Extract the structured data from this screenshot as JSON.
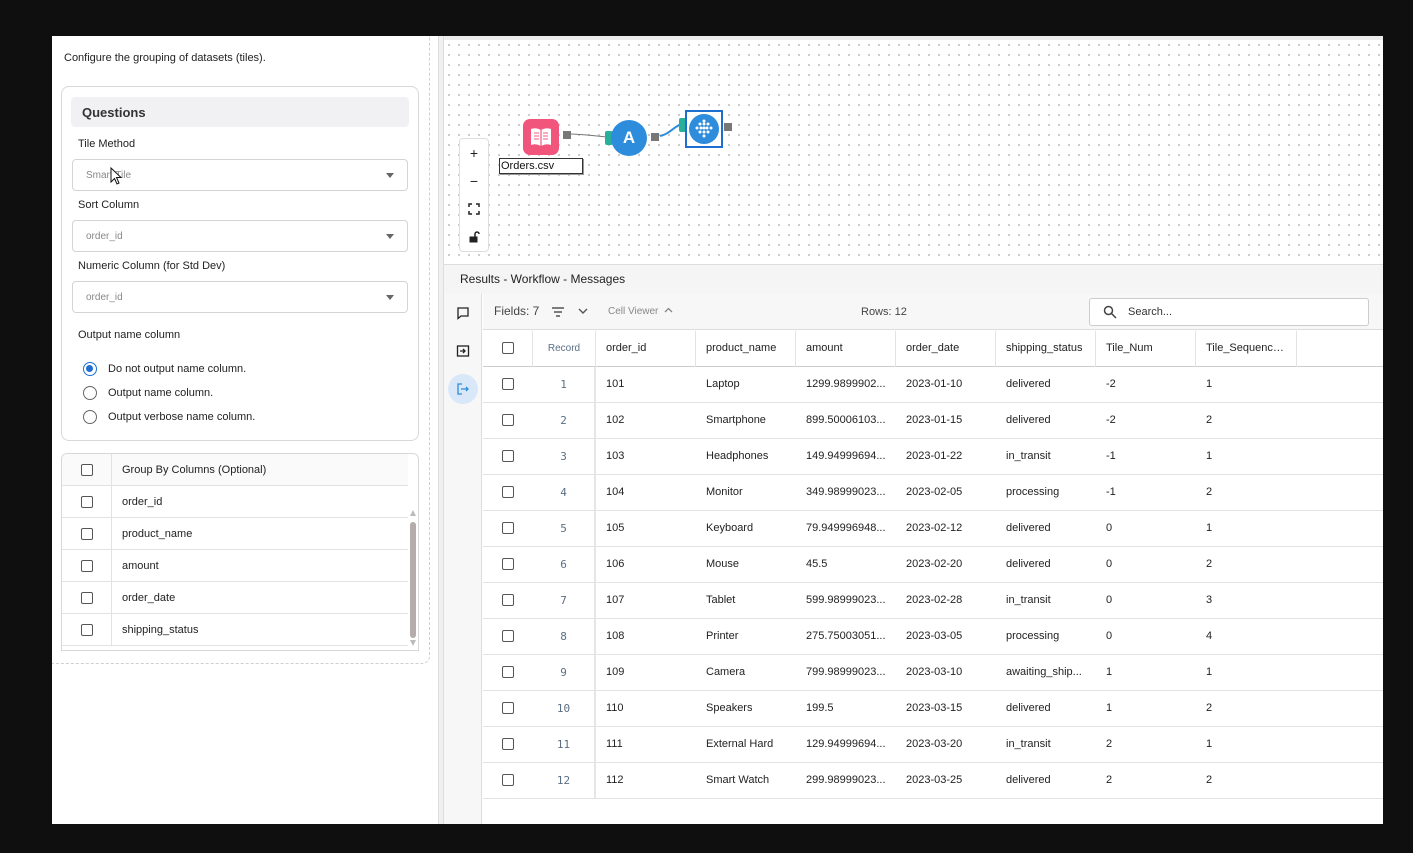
{
  "left": {
    "description": "Configure the grouping of datasets (tiles).",
    "questions_title": "Questions",
    "tile_method_label": "Tile Method",
    "tile_method_value": "Smart Tile",
    "sort_column_label": "Sort Column",
    "sort_column_value": "order_id",
    "numeric_column_label": "Numeric Column (for Std Dev)",
    "numeric_column_value": "order_id",
    "output_name_label": "Output name column",
    "radio_options": [
      {
        "label": "Do not output name column.",
        "selected": true
      },
      {
        "label": "Output name column.",
        "selected": false
      },
      {
        "label": "Output verbose name column.",
        "selected": false
      }
    ],
    "group_by_header": "Group By Columns (Optional)",
    "group_by_columns": [
      "order_id",
      "product_name",
      "amount",
      "order_date",
      "shipping_status"
    ]
  },
  "canvas": {
    "input_node_label": "Orders.csv",
    "select_node_letter": "A",
    "zoom_in": "+",
    "zoom_out": "−"
  },
  "results": {
    "title": "Results - Workflow - Messages",
    "fields_label": "Fields: 7",
    "cell_viewer_label": "Cell Viewer",
    "rows_label": "Rows: 12",
    "search_placeholder": "Search...",
    "columns": [
      "Record",
      "order_id",
      "product_name",
      "amount",
      "order_date",
      "shipping_status",
      "Tile_Num",
      "Tile_Sequence..."
    ],
    "rows": [
      [
        "1",
        "101",
        "Laptop",
        "1299.9899902...",
        "2023-01-10",
        "delivered",
        "-2",
        "1"
      ],
      [
        "2",
        "102",
        "Smartphone",
        "899.50006103...",
        "2023-01-15",
        "delivered",
        "-2",
        "2"
      ],
      [
        "3",
        "103",
        "Headphones",
        "149.94999694...",
        "2023-01-22",
        "in_transit",
        "-1",
        "1"
      ],
      [
        "4",
        "104",
        "Monitor",
        "349.98999023...",
        "2023-02-05",
        "processing",
        "-1",
        "2"
      ],
      [
        "5",
        "105",
        "Keyboard",
        "79.949996948...",
        "2023-02-12",
        "delivered",
        "0",
        "1"
      ],
      [
        "6",
        "106",
        "Mouse",
        "45.5",
        "2023-02-20",
        "delivered",
        "0",
        "2"
      ],
      [
        "7",
        "107",
        "Tablet",
        "599.98999023...",
        "2023-02-28",
        "in_transit",
        "0",
        "3"
      ],
      [
        "8",
        "108",
        "Printer",
        "275.75003051...",
        "2023-03-05",
        "processing",
        "0",
        "4"
      ],
      [
        "9",
        "109",
        "Camera",
        "799.98999023...",
        "2023-03-10",
        "awaiting_ship...",
        "1",
        "1"
      ],
      [
        "10",
        "110",
        "Speakers",
        "199.5",
        "2023-03-15",
        "delivered",
        "1",
        "2"
      ],
      [
        "11",
        "111",
        "External Hard",
        "129.94999694...",
        "2023-03-20",
        "in_transit",
        "2",
        "1"
      ],
      [
        "12",
        "112",
        "Smart Watch",
        "299.98999023...",
        "2023-03-25",
        "delivered",
        "2",
        "2"
      ]
    ]
  },
  "colors": {
    "accent": "#1f6fd1",
    "input_node": "#f2557c",
    "tool_node": "#2d8cdb",
    "anchor": "#29b09a"
  }
}
